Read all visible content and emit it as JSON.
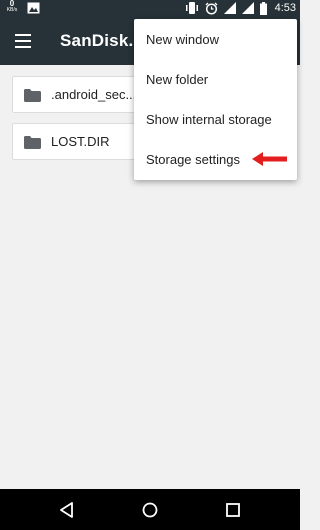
{
  "status_bar": {
    "net_speed_value": "0",
    "net_speed_unit": "KB/s",
    "time": "4:53",
    "icons": [
      "image-icon",
      "vibrate-icon",
      "alarm-icon",
      "wifi-icon",
      "signal-icon",
      "battery-icon"
    ]
  },
  "toolbar": {
    "menu_icon": "hamburger-icon",
    "title": "SanDisk..."
  },
  "files": [
    {
      "name": ".android_sec...",
      "icon": "folder-icon"
    },
    {
      "name": "LOST.DIR",
      "icon": "folder-icon"
    }
  ],
  "overflow_menu": {
    "items": [
      {
        "label": "New window"
      },
      {
        "label": "New folder"
      },
      {
        "label": "Show internal storage"
      },
      {
        "label": "Storage settings"
      }
    ],
    "annotation_color": "#e41e1e"
  },
  "nav_bar": {
    "buttons": [
      "back-icon",
      "home-icon",
      "recents-icon"
    ]
  },
  "colors": {
    "toolbar": "#263238",
    "background": "#f1f1f1",
    "menu_background": "#ffffff"
  }
}
